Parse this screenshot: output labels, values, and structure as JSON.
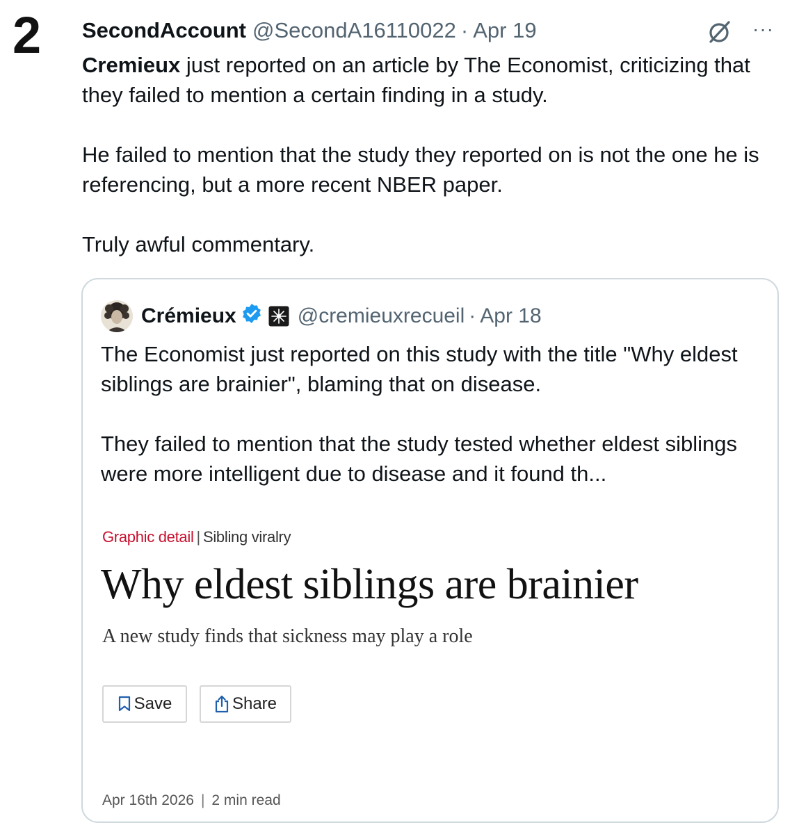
{
  "rank": "2",
  "tweet": {
    "display_name": "SecondAccount",
    "handle": "@SecondA16110022",
    "separator": "·",
    "date": "Apr 19",
    "more_label": "···",
    "mention": "Cremieux",
    "body_line1_rest": " just reported on an article by The Economist, criticizing that they failed to mention a certain finding in a study.",
    "body_para2": "He failed to mention that the study they reported on is not the one he is referencing, but a more recent NBER paper.",
    "body_para3": "Truly awful commentary."
  },
  "quote": {
    "display_name": "Crémieux",
    "handle": "@cremieuxrecueil",
    "separator": "·",
    "date": "Apr 18",
    "body_para1": "The Economist just reported on this study with the title \"Why eldest siblings are brainier\", blaming that on disease.",
    "body_para2": "They failed to mention that the study tested whether eldest siblings were more intelligent due to disease and it found th..."
  },
  "article": {
    "section": "Graphic detail",
    "separator": "|",
    "topic": "Sibling viralry",
    "title": "Why eldest siblings are brainier",
    "subtitle": "A new study finds that sickness may play a role",
    "save_label": "Save",
    "share_label": "Share",
    "date": "Apr 16th 2026",
    "footer_separator": "|",
    "read_time": "2 min read"
  },
  "colors": {
    "accent_blue": "#1d9bf0",
    "secondary_text": "#536471",
    "economist_red": "#c8102e",
    "border": "#cfd9de"
  },
  "icons": [
    "grok-icon",
    "more-icon",
    "verified-icon",
    "org-badge-icon",
    "bookmark-icon",
    "share-icon"
  ]
}
